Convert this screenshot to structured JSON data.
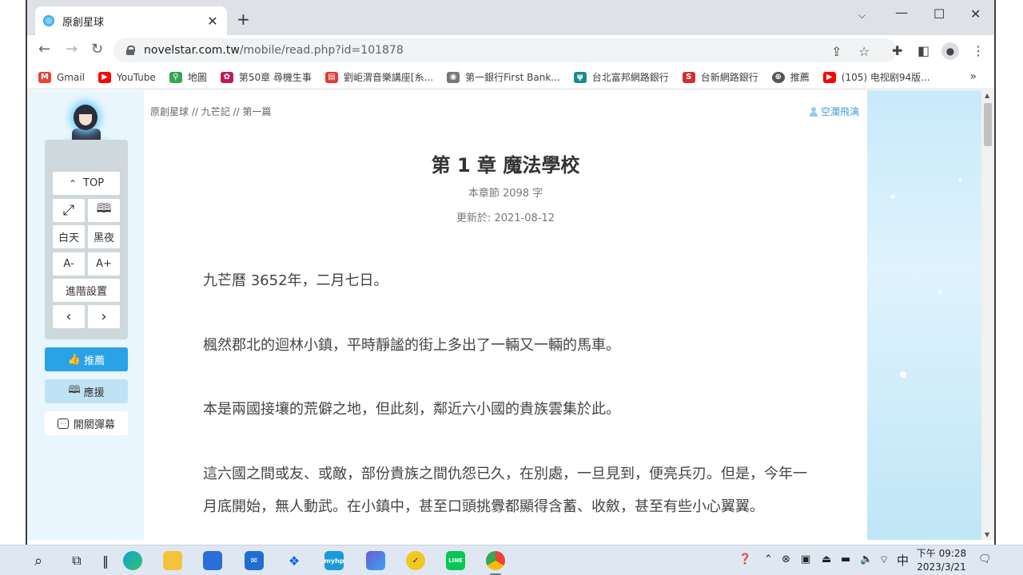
{
  "browser": {
    "tab_title": "原創星球",
    "tab_close": "✕",
    "new_tab": "+",
    "url_host": "novelstar.com.tw",
    "url_path": "/mobile/read.php?id=101878",
    "bookmarks": [
      {
        "label": "Gmail",
        "color": "#ea4335",
        "glyph": "M"
      },
      {
        "label": "YouTube",
        "color": "#ff0000",
        "glyph": "▶"
      },
      {
        "label": "地圖",
        "color": "#34a853",
        "glyph": "⚲"
      },
      {
        "label": "第50章 尋機生事",
        "color": "#c2185b",
        "glyph": "✿"
      },
      {
        "label": "劉岠渭音樂講座[糸...",
        "color": "#e53935",
        "glyph": "▤"
      },
      {
        "label": "第一銀行First Bank...",
        "color": "#777777",
        "glyph": "◉"
      },
      {
        "label": "台北富邦網路銀行",
        "color": "#1a8c8c",
        "glyph": "ψ"
      },
      {
        "label": "台新網路銀行",
        "color": "#d32f2f",
        "glyph": "S"
      },
      {
        "label": "推薦",
        "color": "#555555",
        "glyph": "⊕"
      },
      {
        "label": "(105) 电视剧94版...",
        "color": "#ff0000",
        "glyph": "▶"
      }
    ],
    "bookmarks_more": "»"
  },
  "sidebar": {
    "top_label": "TOP",
    "day_label": "白天",
    "night_label": "黑夜",
    "font_smaller": "A-",
    "font_larger": "A+",
    "advanced_label": "進階設置",
    "prev_label": "‹",
    "next_label": "›",
    "recommend_label": "推薦",
    "support_label": "應援",
    "danmaku_label": "開關彈幕"
  },
  "article": {
    "breadcrumb": "原創星球 // 九芒記 // 第一篇",
    "author": "空瀾飛漓",
    "chapter_title": "第 1 章 魔法學校",
    "word_count": "本章節 2098 字",
    "updated": "更新於: 2021-08-12",
    "paragraphs": [
      "九芒曆 3652年，二月七日。",
      "楓然郡北的迴林小鎮，平時靜謐的街上多出了一輛又一輛的馬車。",
      "本是兩國接壤的荒僻之地，但此刻，鄰近六小國的貴族雲集於此。",
      "這六國之間或友、或敵，部份貴族之間仇怨已久，在別處，一旦見到，便亮兵刃。但是，今年一月底開始，無人動武。在小鎮中，甚至口頭挑釁都顯得含蓄、收斂，甚至有些小心翼翼。"
    ]
  },
  "taskbar": {
    "clock_period_time": "下午 09:28",
    "clock_date": "2023/3/21",
    "ime": "中",
    "hp_label": "myhp"
  }
}
